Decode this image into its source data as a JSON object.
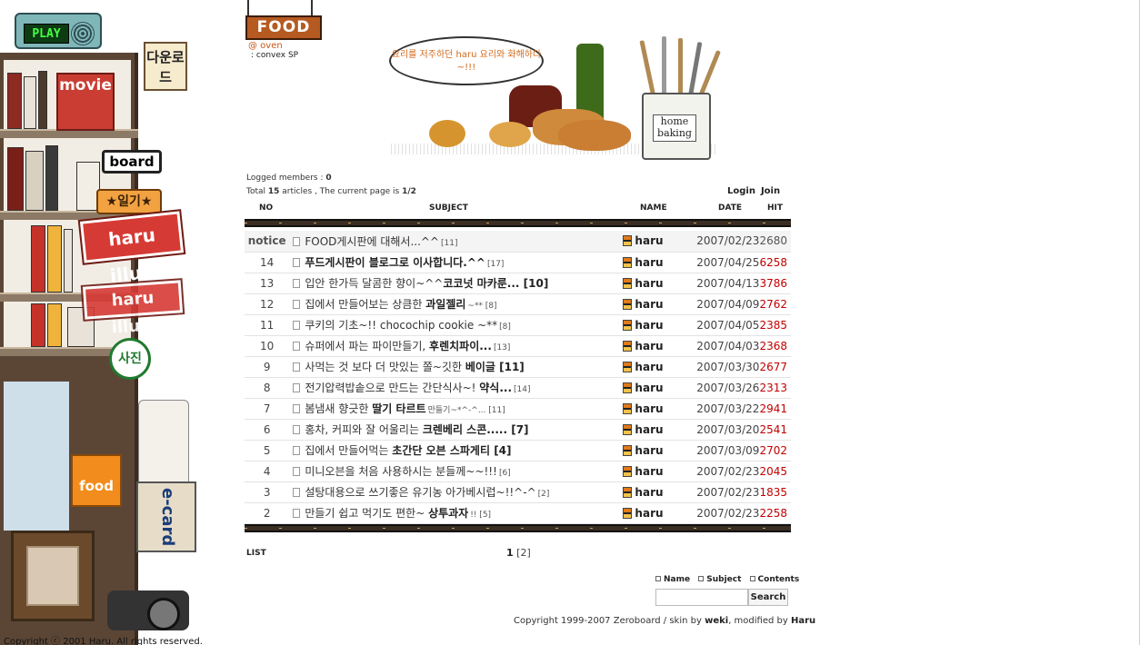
{
  "sidebar": {
    "play_label": "PLAY",
    "download_label": "다운로드",
    "movie_label": "movie",
    "board_label": "board",
    "diary_label": "일기",
    "illust_label": "haru illust",
    "illust_label_2": "haru illust",
    "photo_label": "사진",
    "food_label": "food",
    "ecard_label": "e-card",
    "copyright": "Copyright ⓒ 2001 Haru. All rights reserved."
  },
  "header": {
    "section_title": "FOOD",
    "oven_line": "@ oven",
    "convex_line": ": convex SP",
    "speech_bubble": "요리를 저주하던 haru 요리와 화해하다~!!!",
    "jar_label": "home baking"
  },
  "board": {
    "logged_members_label": "Logged members : ",
    "logged_members_count": "0",
    "total_prefix": "Total ",
    "total_count": "15",
    "total_middle": " articles , The current page is ",
    "current_page": "1/2",
    "login_label": "Login",
    "join_label": "Join",
    "columns": {
      "no": "NO",
      "subject": "SUBJECT",
      "name": "NAME",
      "date": "DATE",
      "hit": "HIT"
    },
    "rows": [
      {
        "no": "notice",
        "plain": "FOOD게시판에 대해서...^^",
        "bold": "",
        "comments": "[11]",
        "name": "haru",
        "date": "2007/02/23",
        "hit": "2680"
      },
      {
        "no": "14",
        "plain": "",
        "bold": "푸드게시판이 블로그로 이사합니다.^^",
        "comments": "[17]",
        "name": "haru",
        "date": "2007/04/25",
        "hit": "6258"
      },
      {
        "no": "13",
        "plain": "입안 한가득 달콤한 향이~^^",
        "bold": "코코넛 마카룬... [10]",
        "comments": "",
        "name": "haru",
        "date": "2007/04/13",
        "hit": "3786"
      },
      {
        "no": "12",
        "plain": "집에서 만들어보는 상큼한 ",
        "bold": "과일젤리",
        "comments": "~** [8]",
        "name": "haru",
        "date": "2007/04/09",
        "hit": "2762"
      },
      {
        "no": "11",
        "plain": "쿠키의 기초~!! chocochip cookie ~**",
        "bold": "",
        "comments": "[8]",
        "name": "haru",
        "date": "2007/04/05",
        "hit": "2385"
      },
      {
        "no": "10",
        "plain": "슈퍼에서 파는 파이만들기, ",
        "bold": "후렌치파이...",
        "comments": "[13]",
        "name": "haru",
        "date": "2007/04/03",
        "hit": "2368"
      },
      {
        "no": "9",
        "plain": "사먹는 것 보다 더 맛있는 쫄~깃한 ",
        "bold": "베이글 [11]",
        "comments": "",
        "name": "haru",
        "date": "2007/03/30",
        "hit": "2677"
      },
      {
        "no": "8",
        "plain": "전기압력밥솥으로 만드는 간단식사~! ",
        "bold": "약식...",
        "comments": "[14]",
        "name": "haru",
        "date": "2007/03/26",
        "hit": "2313"
      },
      {
        "no": "7",
        "plain": "봄냄새 향긋한 ",
        "bold": "딸기 타르트",
        "comments": "만들기~*^-^... [11]",
        "name": "haru",
        "date": "2007/03/22",
        "hit": "2941"
      },
      {
        "no": "6",
        "plain": "홍차, 커피와 잘 어울리는 ",
        "bold": "크렌베리 스콘..... [7]",
        "comments": "",
        "name": "haru",
        "date": "2007/03/20",
        "hit": "2541"
      },
      {
        "no": "5",
        "plain": "집에서 만들어먹는 ",
        "bold": "초간단 오븐 스파게티 [4]",
        "comments": "",
        "name": "haru",
        "date": "2007/03/09",
        "hit": "2702"
      },
      {
        "no": "4",
        "plain": "미니오븐을 처음 사용하시는 분들께~~!!!",
        "bold": "",
        "comments": "[6]",
        "name": "haru",
        "date": "2007/02/23",
        "hit": "2045"
      },
      {
        "no": "3",
        "plain": "설탕대용으로 쓰기좋은 유기농 아가베시럽~!!^-^",
        "bold": "",
        "comments": "[2]",
        "name": "haru",
        "date": "2007/02/23",
        "hit": "1835"
      },
      {
        "no": "2",
        "plain": "만들기 쉽고 먹기도 편한~ ",
        "bold": "상투과자",
        "comments": "!! [5]",
        "name": "haru",
        "date": "2007/02/23",
        "hit": "2258"
      }
    ],
    "list_label": "LIST",
    "pager": {
      "current": "1",
      "other": "[2]"
    },
    "search": {
      "opt_name": "Name",
      "opt_subject": "Subject",
      "opt_contents": "Contents",
      "input_value": "",
      "button_label": "Search"
    },
    "footer": {
      "prefix": "Copyright 1999-2007 Zeroboard / skin by ",
      "skin_author": "weki",
      "middle": ", modified by ",
      "modifier": "Haru"
    }
  },
  "colors": {
    "hit_red": "#c00000",
    "accent_orange": "#b55a20",
    "rule_brown": "#3a2d22"
  }
}
